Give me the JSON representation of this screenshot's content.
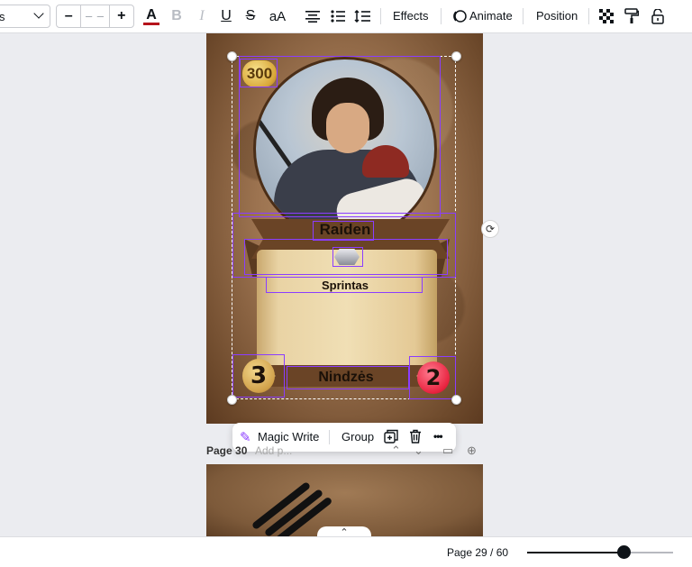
{
  "toolbar": {
    "font_name": "s",
    "font_size_value": "– –",
    "decrease_label": "–",
    "increase_label": "+",
    "text_color_glyph": "A",
    "bold_glyph": "B",
    "italic_glyph": "I",
    "underline_glyph": "U",
    "strike_glyph": "S",
    "case_glyph": "aA",
    "effects_label": "Effects",
    "animate_label": "Animate",
    "position_label": "Position",
    "text_color_swatch": "#b5121b"
  },
  "card": {
    "cost": "300",
    "name": "Raiden",
    "class": "Sprintas",
    "type": "Nindzės",
    "attack": "3",
    "health": "2"
  },
  "context_bar": {
    "magic_write_label": "Magic Write",
    "group_label": "Group",
    "more_glyph": "•••"
  },
  "page_bar": {
    "label": "Page 30",
    "title_placeholder": "Add p..."
  },
  "status_bar": {
    "page_count": "Page 29 / 60",
    "zoom_fraction": 0.66
  },
  "colors": {
    "selection": "#8b3dff",
    "accent": "#8b3dff"
  }
}
